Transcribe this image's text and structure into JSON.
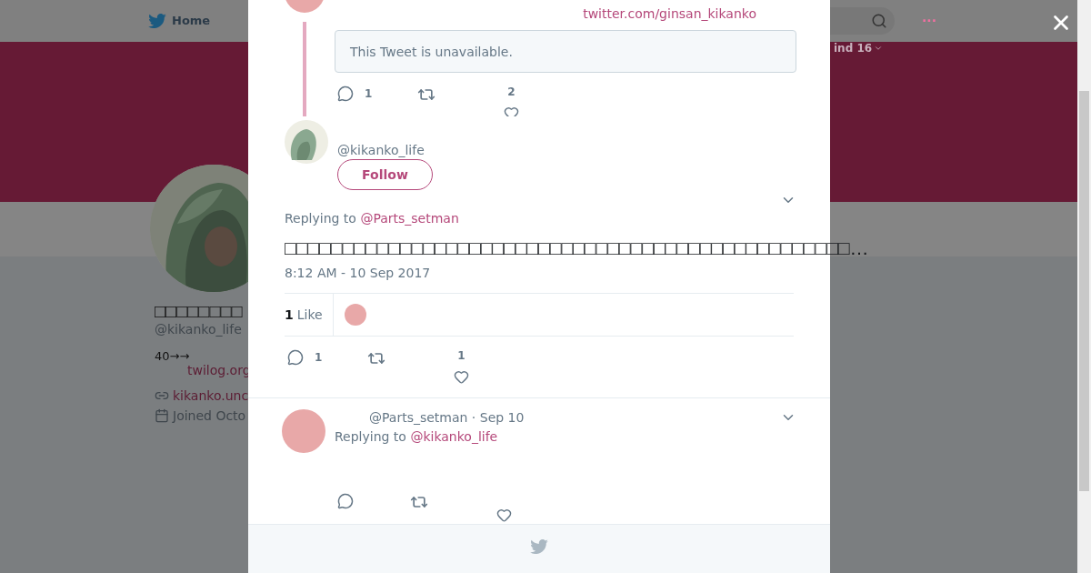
{
  "background_page": {
    "nav": {
      "home": "Home",
      "more": "···"
    },
    "sort_label": "ind 16"
  },
  "profile": {
    "name": "□□□□□□□□",
    "handle": "@kikanko_life",
    "bio": "40→→",
    "bio_link": "twilog.org",
    "website": "kikanko.unc",
    "joined": "Joined Octo"
  },
  "modal": {
    "parent_tweet": {
      "source_link": "twitter.com/ginsan_kikanko",
      "quoted": "This Tweet is unavailable.",
      "replies": "1",
      "likes": "2"
    },
    "main_tweet": {
      "handle": "@kikanko_life",
      "follow": "Follow",
      "replying_label": "Replying to",
      "replying_to": "@Parts_setman",
      "text": "□□□□□□□□□□□□□□□□□□□□□□□□□□□□□□□□□□□□□□□□□□□□□□□□□…",
      "time": "8:12 AM - 10 Sep 2017",
      "like_count": "1",
      "like_label": "Like",
      "replies": "1",
      "likes": "1"
    },
    "reply_tweet": {
      "meta": "@Parts_setman · Sep 10",
      "replying_label": "Replying to",
      "replying_to": "@kikanko_life"
    }
  }
}
